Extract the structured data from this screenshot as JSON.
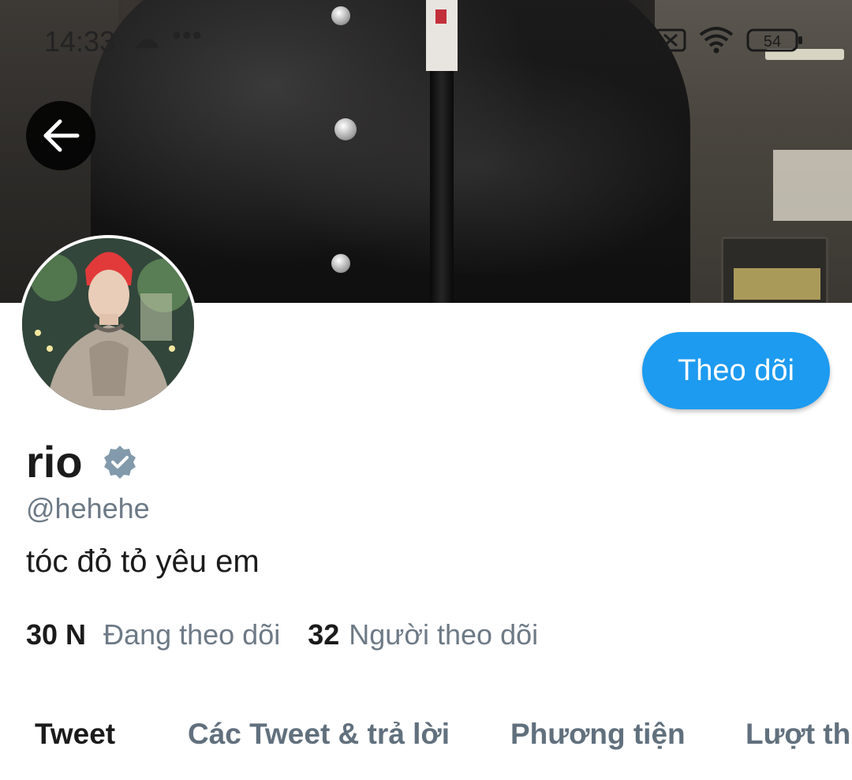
{
  "status_bar": {
    "time": "14:33",
    "battery_level": "54"
  },
  "header": {
    "back_icon": "arrow-left-icon"
  },
  "profile": {
    "display_name": "rio",
    "verified": true,
    "handle": "@hehehe",
    "bio": "tóc đỏ tỏ yêu em",
    "follow_button_label": "Theo dõi",
    "following_count": "30 N",
    "following_label": "Đang theo dõi",
    "followers_count": "32",
    "followers_label": "Người theo dõi"
  },
  "tabs": [
    {
      "label": "Tweet",
      "active": true
    },
    {
      "label": "Các Tweet & trả lời",
      "active": false
    },
    {
      "label": "Phương tiện",
      "active": false
    },
    {
      "label": "Lượt thích",
      "active": false
    }
  ],
  "colors": {
    "accent": "#1d9bf0",
    "muted_text": "#6d7a86",
    "primary_text": "#1b1b1b",
    "verified_badge": "#829aab"
  }
}
